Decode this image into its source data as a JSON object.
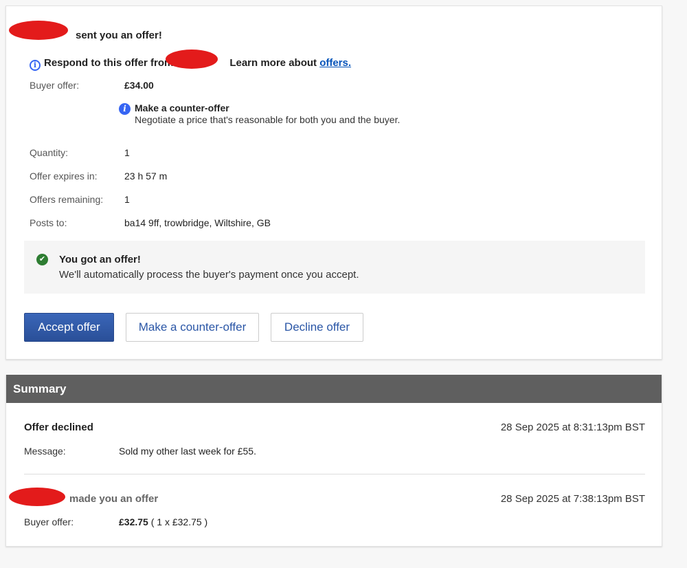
{
  "offer": {
    "headline": "sent you an offer!",
    "respond_text": "Respond to this offer from",
    "learn_more_text": "Learn more about",
    "learn_more_link": "offers.",
    "buyer_offer_label": "Buyer offer:",
    "buyer_offer_value": "£34.00",
    "counter_tip_title": "Make a counter-offer",
    "counter_tip_body": "Negotiate a price that's reasonable for both you and the buyer.",
    "details": [
      {
        "label": "Quantity:",
        "value": "1"
      },
      {
        "label": "Offer expires in:",
        "value": "23 h 57 m"
      },
      {
        "label": "Offers remaining:",
        "value": "1"
      },
      {
        "label": "Posts to:",
        "value": "ba14 9ff, trowbridge, Wiltshire, GB"
      }
    ],
    "notice_title": "You got an offer!",
    "notice_body": "We'll automatically process the buyer's payment once you accept.",
    "buttons": {
      "accept": "Accept offer",
      "counter": "Make a counter-offer",
      "decline": "Decline offer"
    }
  },
  "summary": {
    "header": "Summary",
    "entries": [
      {
        "title": "Offer declined",
        "date": "28 Sep 2025 at 8:31:13pm BST",
        "field_label": "Message:",
        "field_value": "Sold my other last week for £55."
      },
      {
        "title": "made you an offer",
        "date": "28 Sep 2025 at 7:38:13pm BST",
        "field_label": "Buyer offer:",
        "field_value_bold": "£32.75",
        "field_value_rest": " ( 1 x £32.75 )"
      }
    ]
  },
  "colors": {
    "redaction": "#e31b1b",
    "primary_button": "#2a4f98",
    "link": "#0654ba",
    "info_icon": "#3665f3",
    "success_icon": "#2e7d32",
    "summary_header": "#5f5f5f"
  }
}
